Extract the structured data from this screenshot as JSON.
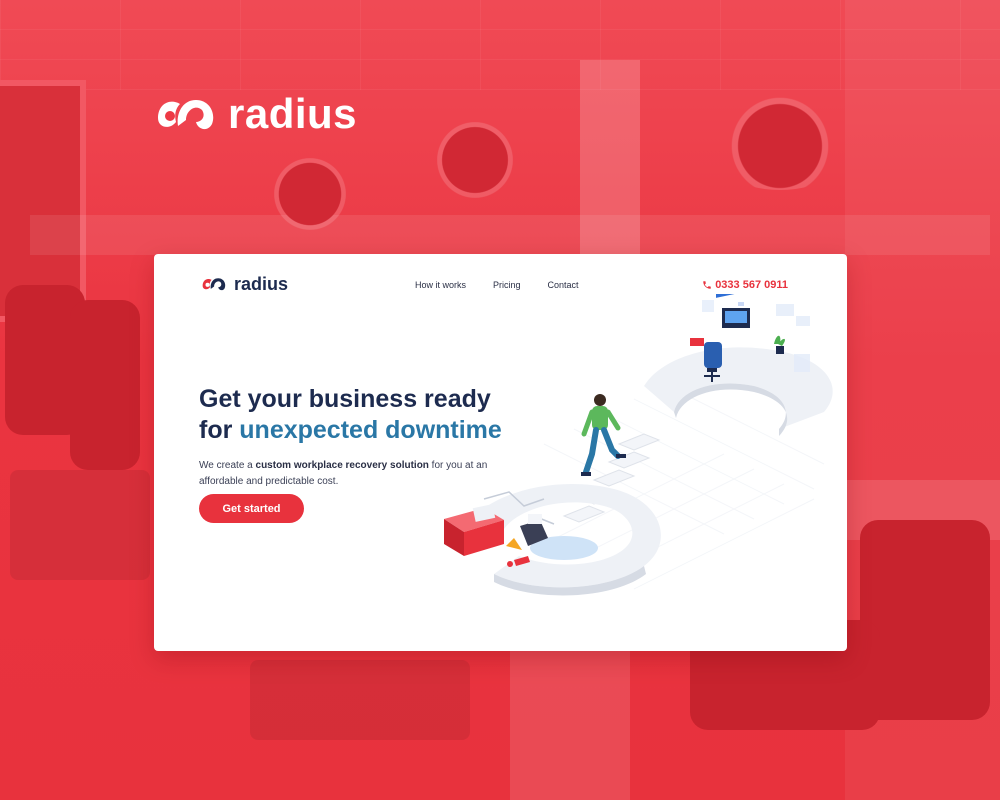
{
  "brand": {
    "name": "radius"
  },
  "nav": {
    "logo_text": "radius",
    "links": [
      {
        "label": "How it works"
      },
      {
        "label": "Pricing"
      },
      {
        "label": "Contact"
      }
    ],
    "phone": "0333 567 0911"
  },
  "hero": {
    "headline_line1": "Get your business ready",
    "headline_line2_prefix": "for ",
    "headline_line2_accent": "unexpected downtime",
    "sub_prefix": "We create a ",
    "sub_bold": "custom workplace recovery solution",
    "sub_suffix": " for you at an affordable and predictable cost.",
    "cta_label": "Get started"
  },
  "colors": {
    "brand_red": "#e8323d",
    "navy": "#1d2b4f",
    "accent_blue": "#2a77a6"
  },
  "icons": [
    "radius-logo-icon",
    "phone-icon"
  ]
}
